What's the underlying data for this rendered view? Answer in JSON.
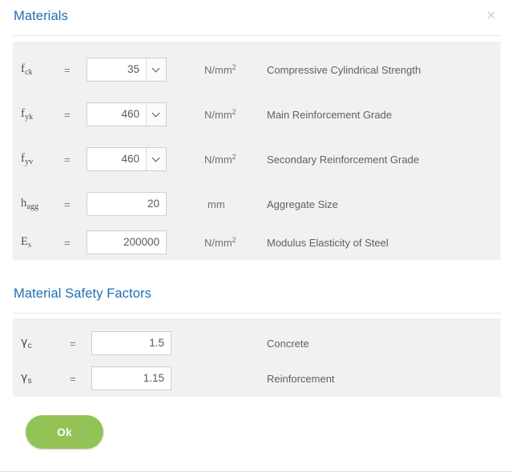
{
  "dialog": {
    "title": "Materials",
    "close_icon": "×"
  },
  "materials": {
    "rows": [
      {
        "symbol": "f",
        "subscript": "ck",
        "equals": "=",
        "control": "select",
        "value": "35",
        "unit": "N/mm",
        "unit_sup": "2",
        "description": "Compressive Cylindrical Strength"
      },
      {
        "symbol": "f",
        "subscript": "yk",
        "equals": "=",
        "control": "select",
        "value": "460",
        "unit": "N/mm",
        "unit_sup": "2",
        "description": "Main Reinforcement Grade"
      },
      {
        "symbol": "f",
        "subscript": "yv",
        "equals": "=",
        "control": "select",
        "value": "460",
        "unit": "N/mm",
        "unit_sup": "2",
        "description": "Secondary Reinforcement Grade"
      },
      {
        "symbol": "h",
        "subscript": "agg",
        "equals": "=",
        "control": "input",
        "value": "20",
        "unit": "mm",
        "unit_sup": "",
        "description": "Aggregate Size"
      },
      {
        "symbol": "E",
        "subscript": "s",
        "equals": "=",
        "control": "input",
        "value": "200000",
        "unit": "N/mm",
        "unit_sup": "2",
        "description": "Modulus Elasticity of Steel"
      }
    ]
  },
  "safety": {
    "title": "Material Safety Factors",
    "rows": [
      {
        "symbol": "γ",
        "subscript": "c",
        "equals": "=",
        "control": "input",
        "value": "1.5",
        "description": "Concrete"
      },
      {
        "symbol": "γ",
        "subscript": "s",
        "equals": "=",
        "control": "input",
        "value": "1.15",
        "description": "Reinforcement"
      }
    ]
  },
  "footer": {
    "ok_label": "Ok"
  },
  "colors": {
    "heading_blue": "#1f6eb5",
    "panel_gray": "#f1f1f1",
    "ok_green": "#93c356"
  }
}
